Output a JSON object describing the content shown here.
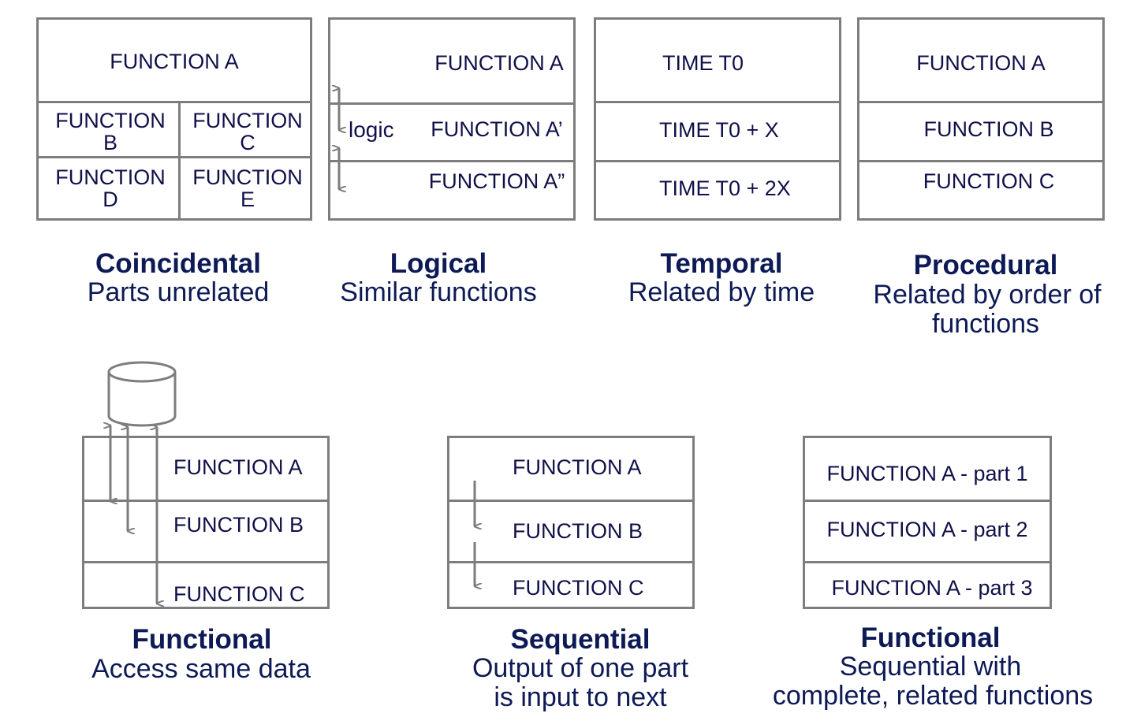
{
  "panels": {
    "coincidental": {
      "cells": [
        "FUNCTION A",
        "FUNCTION\nB",
        "FUNCTION\nC",
        "FUNCTION\nD",
        "FUNCTION\nE"
      ],
      "title": "Coincidental",
      "subtitle": [
        "Parts unrelated"
      ]
    },
    "logical": {
      "logic_label": "logic",
      "cells": [
        "FUNCTION A",
        "FUNCTION A’",
        "FUNCTION A”"
      ],
      "title": "Logical",
      "subtitle": [
        "Similar functions"
      ]
    },
    "temporal": {
      "cells": [
        "TIME T0",
        "TIME T0 + X",
        "TIME T0 + 2X"
      ],
      "title": "Temporal",
      "subtitle": [
        "Related by time"
      ]
    },
    "procedural": {
      "cells": [
        "FUNCTION A",
        "FUNCTION B",
        "FUNCTION C"
      ],
      "title": "Procedural",
      "subtitle": [
        "Related by order of",
        "functions"
      ]
    },
    "functional_data": {
      "data_label": "DATA",
      "cells": [
        "FUNCTION A",
        "FUNCTION B",
        "FUNCTION C"
      ],
      "title": "Functional",
      "subtitle": [
        "Access same data"
      ]
    },
    "sequential": {
      "cells": [
        "FUNCTION A",
        "FUNCTION B",
        "FUNCTION C"
      ],
      "title": "Sequential",
      "subtitle": [
        "Output of one part",
        "is input to next"
      ]
    },
    "functional_seq": {
      "cells": [
        "FUNCTION A - part 1",
        "FUNCTION A - part 2",
        "FUNCTION A - part 3"
      ],
      "title": "Functional",
      "subtitle": [
        "Sequential with",
        "complete, related functions"
      ]
    }
  },
  "colors": {
    "border": "#7d7d7d",
    "text": "#10104a",
    "caption": "#0d1a55"
  }
}
